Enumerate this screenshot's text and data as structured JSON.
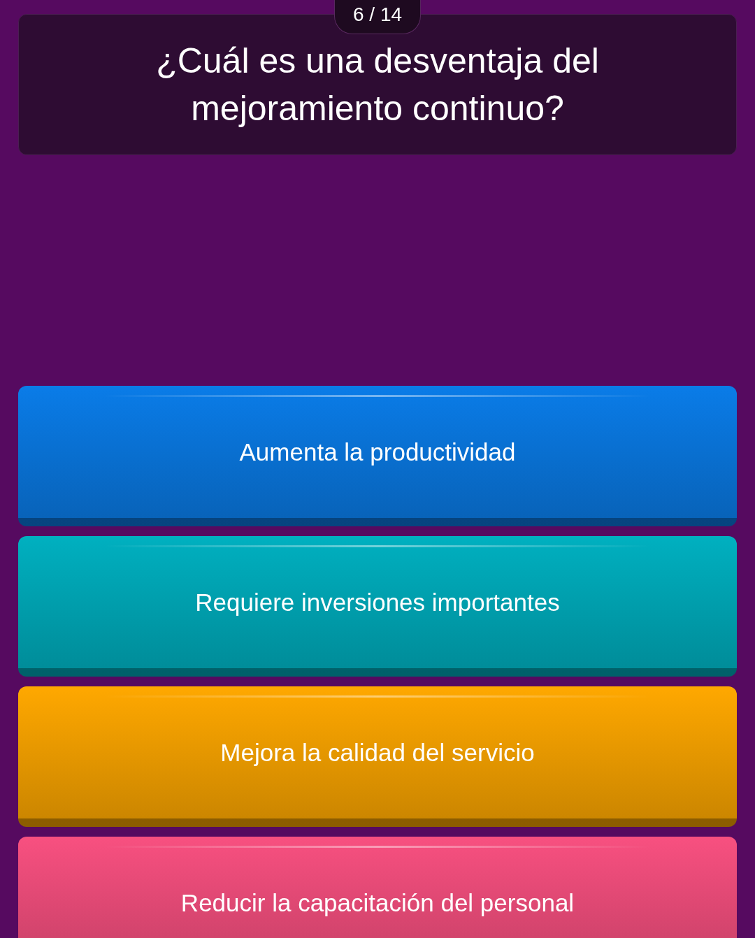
{
  "counter": "6 / 14",
  "question": "¿Cuál es una desventaja del mejoramiento continuo?",
  "answers": [
    {
      "text": "Aumenta la productividad",
      "color": "#0a7ce8"
    },
    {
      "text": "Requiere inversiones importantes",
      "color": "#00b0c0"
    },
    {
      "text": "Mejora la calidad del servicio",
      "color": "#ffa800"
    },
    {
      "text": "Reducir la capacitación del personal",
      "color": "#f85080"
    }
  ]
}
